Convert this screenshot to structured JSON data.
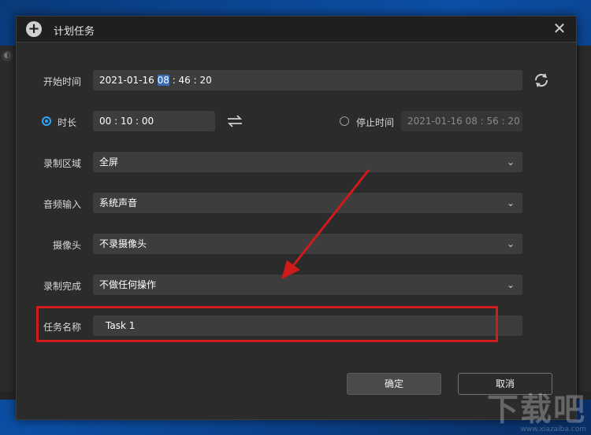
{
  "dialog": {
    "title": "计划任务",
    "start_time": {
      "label": "开始时间",
      "date": "2021-01-16",
      "hour": "08",
      "minute": "46",
      "second": "20"
    },
    "duration": {
      "label": "时长",
      "selected": true,
      "value": "00 : 10 : 00"
    },
    "stop_time": {
      "label": "停止时间",
      "selected": false,
      "value": "2021-01-16 08 : 56 : 20"
    },
    "record_area": {
      "label": "录制区域",
      "value": "全屏"
    },
    "audio_input": {
      "label": "音频输入",
      "value": "系统声音"
    },
    "camera": {
      "label": "摄像头",
      "value": "不录摄像头"
    },
    "on_complete": {
      "label": "录制完成",
      "value": "不做任何操作"
    },
    "task_name": {
      "label": "任务名称",
      "value": "Task 1"
    },
    "ok_label": "确定",
    "cancel_label": "取消"
  },
  "watermark": {
    "big": "下载吧",
    "small": "www.xiazaiba.com"
  },
  "colors": {
    "accent": "#2ea6ff",
    "annotation": "#d11a1a",
    "dialog_bg": "#2b2b2b"
  }
}
